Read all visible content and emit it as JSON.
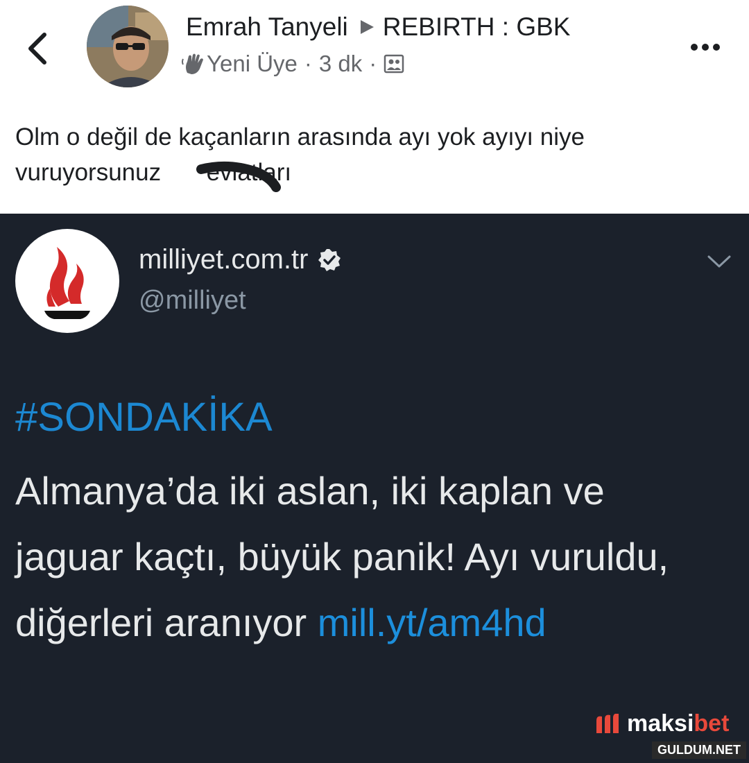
{
  "fb_post": {
    "author": "Emrah Tanyeli",
    "group": "REBIRTH : GBK",
    "badge": "Yeni Üye",
    "time": "3 dk",
    "separator": "·",
    "text": "Olm o değil de kaçanların arasında ayı yok ayıyı niye vuruyorsunuz",
    "text_end": "evlatları"
  },
  "tweet": {
    "name": "milliyet.com.tr",
    "handle": "@milliyet",
    "hashtag": "#SONDAKİKA",
    "body": "Almanya’da iki aslan, iki kaplan ve jaguar kaçtı, büyük panik! Ayı vuruldu, diğerleri aranıyor",
    "link": "mill.yt/am4hd"
  },
  "watermarks": {
    "maksibet_prefix": "maksi",
    "maksibet_accent": "bet",
    "site": "GULDUM.NET"
  },
  "colors": {
    "tweet_background": "#1b212b",
    "twitter_blue": "#1d9bf0",
    "milliyet_red": "#d42a2a",
    "maksibet_red": "#e8493b"
  },
  "icons": [
    "back-icon",
    "play-arrow-icon",
    "wave-hand-icon",
    "group-icon",
    "more-icon",
    "verified-icon",
    "chevron-down-icon",
    "milliyet-logo"
  ]
}
